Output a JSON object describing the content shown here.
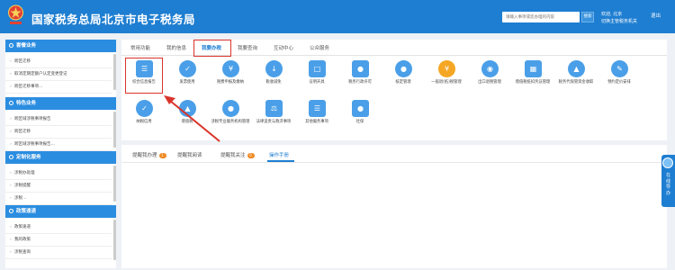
{
  "header": {
    "title": "国家税务总局北京市电子税务局",
    "search_placeholder": "请输入事项或您办理的内容",
    "search_button": "搜索",
    "user_greeting": "欢迎, 北京",
    "user_switch": "切换主管税务机关",
    "logout": "退出",
    "colors": {
      "bar": "#1e7ed1",
      "logo": "#e34234"
    }
  },
  "sidebar": {
    "sections": [
      {
        "title": "套餐业务",
        "items": [
          "跨区迁移",
          "取消定期定额户认定变更登记",
          "跨区迁移事项…"
        ]
      },
      {
        "title": "特色业务",
        "items": [
          "跨区域涉税事项报告",
          "跨区迁移",
          "跨区域涉税事项报告…"
        ]
      },
      {
        "title": "定制化服务",
        "items": [
          "涉税办处理",
          "涉税提醒",
          "涉税…"
        ]
      },
      {
        "title": "政策速递",
        "items": [
          "政策速递",
          "我的政策",
          "涉税查询"
        ]
      }
    ]
  },
  "main": {
    "tabs": [
      "常用功能",
      "我的信息",
      "我要办税",
      "我要查询",
      "互动中心",
      "公众服务"
    ],
    "active_tab_index": 2,
    "row1": [
      {
        "label": "综合信息报告",
        "icon": "report-icon",
        "selected": true
      },
      {
        "label": "发票使用",
        "icon": "invoice-icon"
      },
      {
        "label": "税费申报及缴纳",
        "icon": "tax-declaration-icon"
      },
      {
        "label": "税收减免",
        "icon": "tax-relief-icon"
      },
      {
        "label": "证明开具",
        "icon": "certificate-icon"
      },
      {
        "label": "税务行政许可",
        "icon": "permit-icon"
      },
      {
        "label": "核定管理",
        "icon": "verify-icon"
      },
      {
        "label": "一般退(抵)税管理",
        "icon": "refund-icon"
      },
      {
        "label": "出口退税管理",
        "icon": "export-refund-icon"
      },
      {
        "label": "增值税抵扣凭证管理",
        "icon": "vat-deduction-icon"
      },
      {
        "label": "税务代保管资金收取",
        "icon": "custody-funds-icon"
      },
      {
        "label": "预约定价安排",
        "icon": "pricing-icon"
      }
    ],
    "row2": [
      {
        "label": "纳税信用",
        "icon": "credit-icon"
      },
      {
        "label": "增值税",
        "icon": "vat-icon"
      },
      {
        "label": "涉税专业服务机构管理",
        "icon": "service-agency-icon"
      },
      {
        "label": "法律追责与救济事项",
        "icon": "legal-icon"
      },
      {
        "label": "其他服务事项",
        "icon": "other-services-icon"
      },
      {
        "label": "社保",
        "icon": "social-security-icon"
      }
    ]
  },
  "bottom": {
    "tabs": [
      {
        "label": "提醒我办理",
        "badge": "1"
      },
      {
        "label": "提醒我阅读",
        "badge": ""
      },
      {
        "label": "提醒我关注",
        "badge": "0"
      },
      {
        "label": "操作手册",
        "badge": ""
      }
    ],
    "active_tab_index": 3
  },
  "float_widget": {
    "label": "在线导办"
  },
  "annotation": {
    "color": "#d9342b"
  }
}
